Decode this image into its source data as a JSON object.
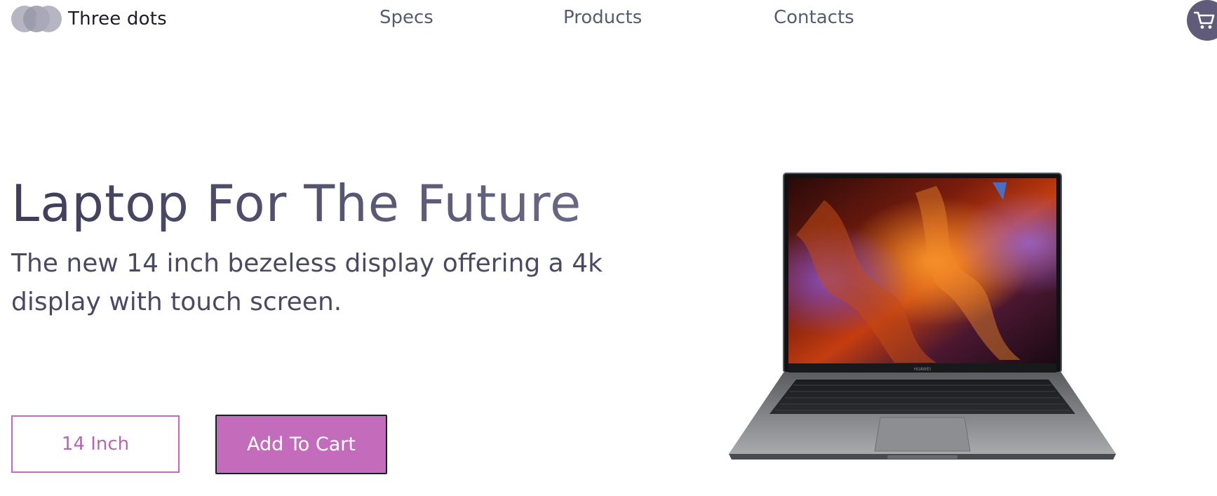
{
  "header": {
    "logo_text": "Three dots",
    "nav": [
      {
        "label": "Specs"
      },
      {
        "label": "Products"
      },
      {
        "label": "Contacts"
      }
    ],
    "cart_icon": "cart-icon"
  },
  "hero": {
    "title": "Laptop For The Future",
    "subtitle": "The new 14 inch bezeless display offering a 4k display with touch screen.",
    "size_button_label": "14 Inch",
    "add_to_cart_label": "Add To Cart",
    "laptop_brand": "HUAWEI"
  },
  "colors": {
    "accent": "#c46cbc",
    "title_start": "#3f3c59",
    "title_end": "#6a6784",
    "nav_text": "#5a5a72",
    "cart_bg": "#5f5b78"
  }
}
